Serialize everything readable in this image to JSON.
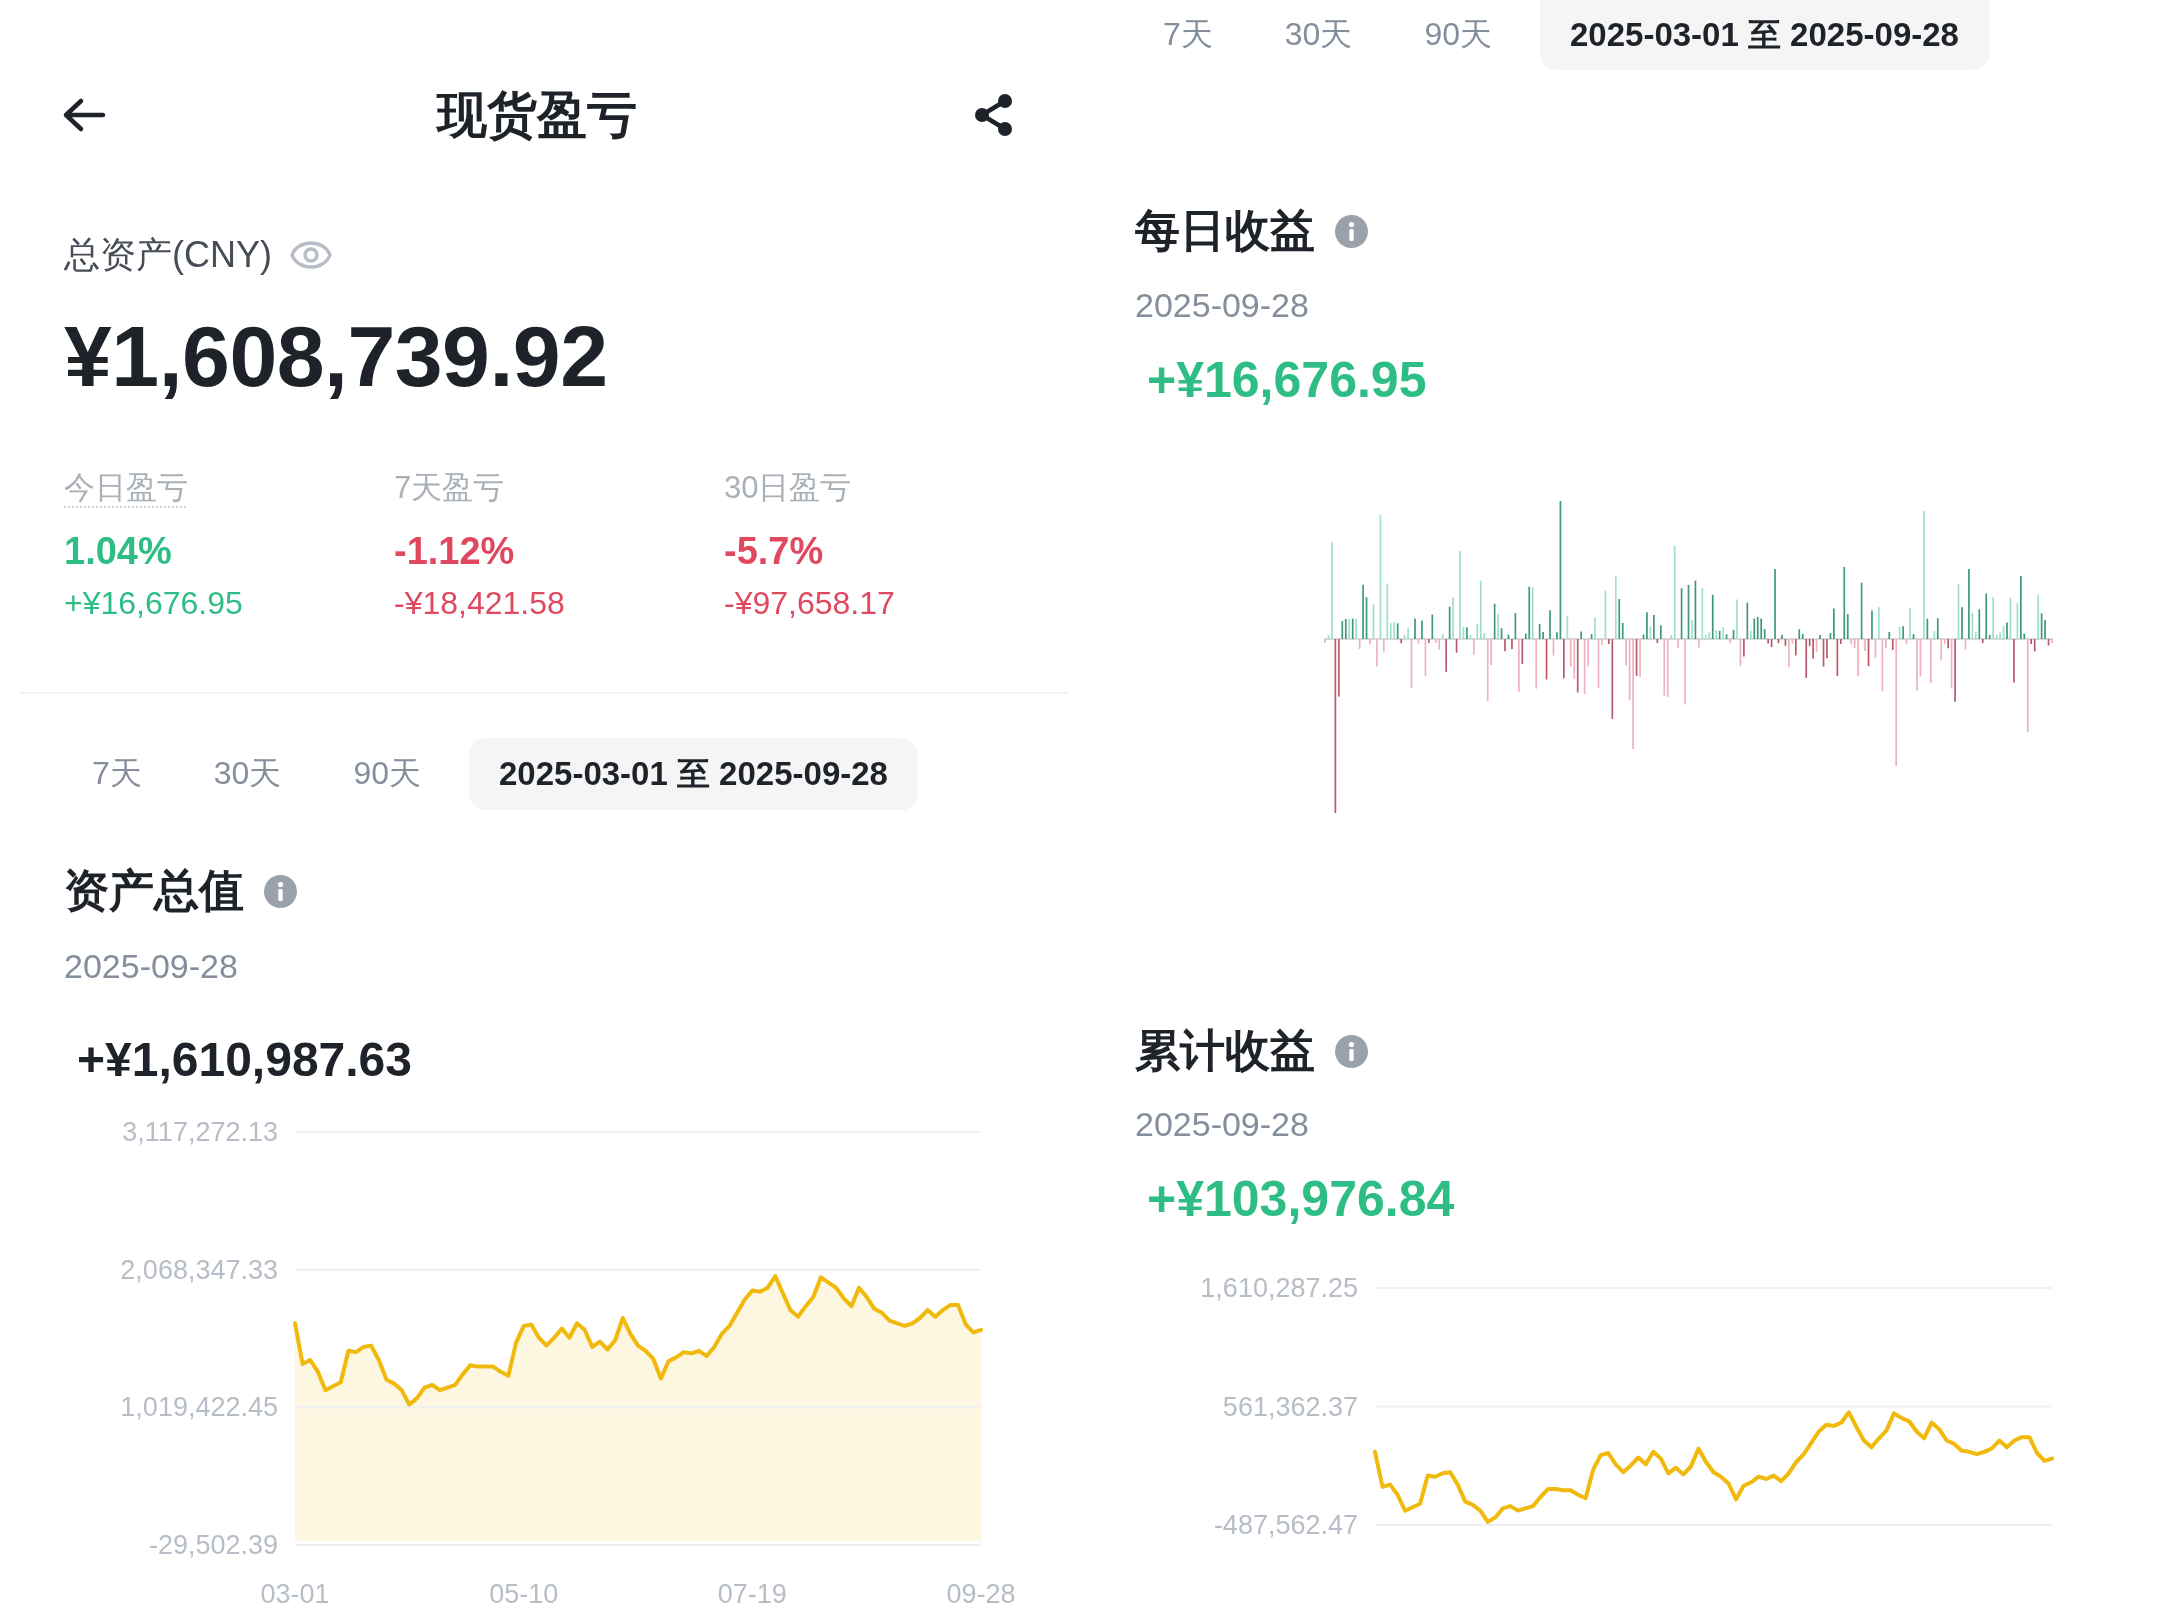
{
  "left_screen": {
    "header": {
      "title": "现货盈亏"
    },
    "total_assets": {
      "label": "总资产(CNY)",
      "value": "¥1,608,739.92"
    },
    "pnl_stats": [
      {
        "label": "今日盈亏",
        "percent": "1.04%",
        "amount": "+¥16,676.95",
        "color": "#2ebd85",
        "dotted_underline": true
      },
      {
        "label": "7天盈亏",
        "percent": "-1.12%",
        "amount": "-¥18,421.58",
        "color": "#e0485f",
        "dotted_underline": false
      },
      {
        "label": "30日盈亏",
        "percent": "-5.7%",
        "amount": "-¥97,658.17",
        "color": "#e0485f",
        "dotted_underline": false
      }
    ],
    "range_tabs": [
      {
        "label": "7天",
        "selected": false
      },
      {
        "label": "30天",
        "selected": false
      },
      {
        "label": "90天",
        "selected": false
      },
      {
        "label": "2025-03-01 至 2025-09-28",
        "selected": true
      }
    ],
    "asset_value": {
      "title": "资产总值",
      "date": "2025-09-28",
      "value": "+¥1,610,987.63",
      "colored": false,
      "chart_data": [
        {
          "type": "area",
          "color": "#f0b90b",
          "grid": true,
          "ylim": [
            -29502.39,
            3117272.13
          ],
          "yticks": [
            {
              "value": 3117272.13,
              "label": "3,117,272.13"
            },
            {
              "value": 2068347.33,
              "label": "2,068,347.33"
            },
            {
              "value": 1019422.45,
              "label": "1,019,422.45"
            },
            {
              "value": -29502.39,
              "label": "-29,502.39"
            }
          ],
          "categories": [
            "03-01",
            null,
            null,
            null,
            null,
            null,
            null,
            null,
            null,
            null,
            null,
            null,
            null,
            null,
            null,
            null,
            null,
            null,
            null,
            null,
            null,
            null,
            null,
            null,
            null,
            null,
            null,
            null,
            null,
            null,
            "05-10",
            null,
            null,
            null,
            null,
            null,
            null,
            null,
            null,
            null,
            null,
            null,
            null,
            null,
            null,
            null,
            null,
            null,
            null,
            null,
            null,
            null,
            null,
            null,
            null,
            null,
            null,
            null,
            null,
            null,
            "07-19",
            null,
            null,
            null,
            null,
            null,
            null,
            null,
            null,
            null,
            null,
            null,
            null,
            null,
            null,
            null,
            null,
            null,
            null,
            null,
            null,
            null,
            null,
            null,
            null,
            null,
            null,
            null,
            null,
            null,
            "09-28"
          ],
          "values": [
            1660000,
            1350000,
            1380000,
            1290000,
            1150000,
            1180000,
            1210000,
            1450000,
            1440000,
            1480000,
            1490000,
            1380000,
            1230000,
            1200000,
            1150000,
            1040000,
            1090000,
            1170000,
            1190000,
            1150000,
            1170000,
            1190000,
            1270000,
            1340000,
            1330000,
            1330000,
            1330000,
            1290000,
            1260000,
            1510000,
            1640000,
            1650000,
            1550000,
            1490000,
            1550000,
            1620000,
            1550000,
            1660000,
            1610000,
            1480000,
            1520000,
            1460000,
            1530000,
            1700000,
            1580000,
            1490000,
            1450000,
            1390000,
            1240000,
            1370000,
            1400000,
            1440000,
            1430000,
            1450000,
            1410000,
            1480000,
            1580000,
            1640000,
            1740000,
            1840000,
            1910000,
            1900000,
            1930000,
            2020000,
            1890000,
            1760000,
            1710000,
            1790000,
            1860000,
            2010000,
            1970000,
            1930000,
            1850000,
            1790000,
            1930000,
            1860000,
            1770000,
            1740000,
            1680000,
            1660000,
            1640000,
            1660000,
            1700000,
            1760000,
            1710000,
            1760000,
            1800000,
            1800000,
            1650000,
            1590000,
            1610000
          ]
        }
      ]
    }
  },
  "right_screen": {
    "range_tabs": [
      {
        "label": "7天",
        "selected": false
      },
      {
        "label": "30天",
        "selected": false
      },
      {
        "label": "90天",
        "selected": false
      },
      {
        "label": "2025-03-01 至 2025-09-28",
        "selected": true
      }
    ],
    "daily_profit": {
      "title": "每日收益",
      "date": "2025-09-28",
      "value": "+¥16,676.95",
      "colored": true
    },
    "cumulative_profit": {
      "title": "累计收益",
      "date": "2025-09-28",
      "value": "+¥103,976.84",
      "colored": true,
      "chart_data": [
        {
          "type": "line",
          "color": "#f0b90b",
          "grid": true,
          "ylim": [
            -487562.47,
            1610287.25
          ],
          "yticks": [
            {
              "value": 1610287.25,
              "label": "1,610,287.25"
            },
            {
              "value": 561362.37,
              "label": "561,362.37"
            },
            {
              "value": -487562.47,
              "label": "-487,562.47"
            }
          ],
          "values": [
            160000,
            -150000,
            -130000,
            -220000,
            -360000,
            -330000,
            -300000,
            -50000,
            -60000,
            -30000,
            -20000,
            -130000,
            -280000,
            -310000,
            -360000,
            -460000,
            -420000,
            -340000,
            -320000,
            -360000,
            -340000,
            -320000,
            -240000,
            -170000,
            -170000,
            -180000,
            -180000,
            -220000,
            -250000,
            0,
            130000,
            150000,
            50000,
            -20000,
            40000,
            110000,
            50000,
            160000,
            100000,
            -30000,
            20000,
            -40000,
            30000,
            190000,
            70000,
            -20000,
            -60000,
            -120000,
            -260000,
            -140000,
            -110000,
            -60000,
            -80000,
            -50000,
            -100000,
            -30000,
            70000,
            140000,
            240000,
            340000,
            400000,
            390000,
            420000,
            510000,
            380000,
            260000,
            200000,
            280000,
            350000,
            500000,
            460000,
            430000,
            340000,
            280000,
            420000,
            360000,
            260000,
            230000,
            170000,
            160000,
            140000,
            160000,
            190000,
            260000,
            200000,
            260000,
            290000,
            290000,
            150000,
            80000,
            100000
          ]
        }
      ]
    }
  }
}
